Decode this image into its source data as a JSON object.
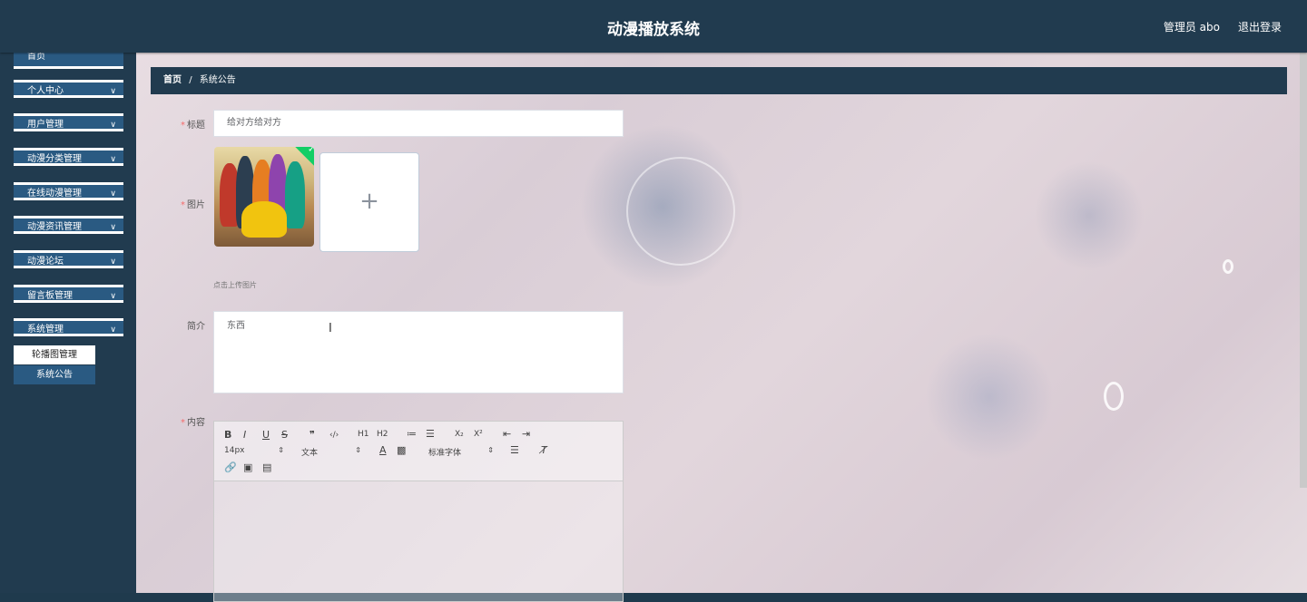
{
  "header": {
    "title": "动漫播放系统",
    "user": "管理员 abo",
    "logout": "退出登录"
  },
  "sidebar": {
    "top_item": "首页",
    "items": [
      {
        "label": "个人中心"
      },
      {
        "label": "用户管理"
      },
      {
        "label": "动漫分类管理"
      },
      {
        "label": "在线动漫管理"
      },
      {
        "label": "动漫资讯管理"
      },
      {
        "label": "动漫论坛"
      },
      {
        "label": "留言板管理"
      },
      {
        "label": "系统管理"
      }
    ],
    "submenu": [
      {
        "label": "轮播图管理"
      },
      {
        "label": "系统公告"
      }
    ],
    "chevron": "chevron-down-icon"
  },
  "breadcrumb": {
    "home": "首页",
    "separator": "/",
    "current": "系统公告"
  },
  "form": {
    "title_label": "标题",
    "title_value": "给对方给对方",
    "image_label": "图片",
    "upload_hint": "点击上传图片",
    "intro_label": "简介",
    "intro_value": "东西",
    "content_label": "内容",
    "required_mark": "*"
  },
  "editor": {
    "font_size": "14px",
    "header_select": "文本",
    "font_family": "标准字体",
    "buttons": [
      "B",
      "I",
      "U",
      "S",
      "❞",
      "‹/›",
      "H1",
      "H2",
      "≔",
      "☰",
      "X₂",
      "X²",
      "⇤",
      "⇥"
    ]
  },
  "colors": {
    "header_bg": "#213b4f",
    "menu_bg": "#2a5a82",
    "required": "#f56c6c"
  }
}
